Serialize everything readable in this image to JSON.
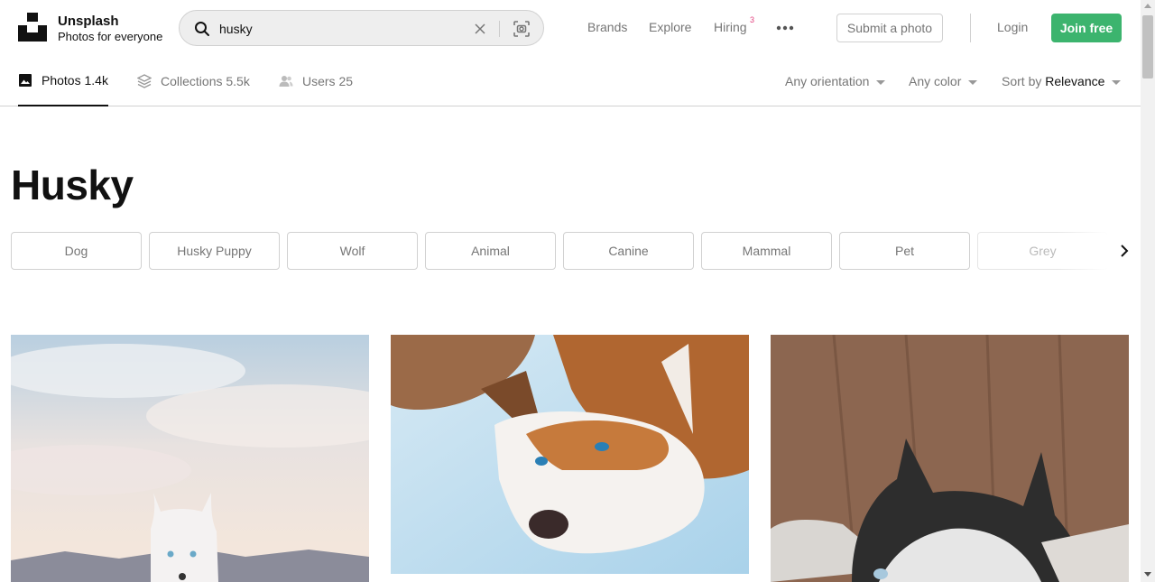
{
  "brand": {
    "name": "Unsplash",
    "tagline": "Photos for everyone"
  },
  "search": {
    "value": "husky",
    "icons": [
      "search-icon",
      "clear-icon",
      "visual-search-icon"
    ]
  },
  "nav": {
    "brands": "Brands",
    "explore": "Explore",
    "hiring": "Hiring",
    "hiring_badge": "3",
    "more_icon": "more-icon"
  },
  "actions": {
    "submit": "Submit a photo",
    "login": "Login",
    "join": "Join free"
  },
  "tabs": [
    {
      "label": "Photos 1.4k",
      "icon": "image-icon",
      "active": true
    },
    {
      "label": "Collections 5.5k",
      "icon": "collections-icon",
      "active": false
    },
    {
      "label": "Users 25",
      "icon": "users-icon",
      "active": false
    }
  ],
  "filters": {
    "orientation": "Any orientation",
    "color": "Any color",
    "sort_prefix": "Sort by",
    "sort_value": "Relevance"
  },
  "title": "Husky",
  "related": [
    "Dog",
    "Husky Puppy",
    "Wolf",
    "Animal",
    "Canine",
    "Mammal",
    "Pet",
    "Grey"
  ],
  "colors": {
    "join_button": "#3cb46e",
    "hiring_badge": "#e3427f"
  }
}
